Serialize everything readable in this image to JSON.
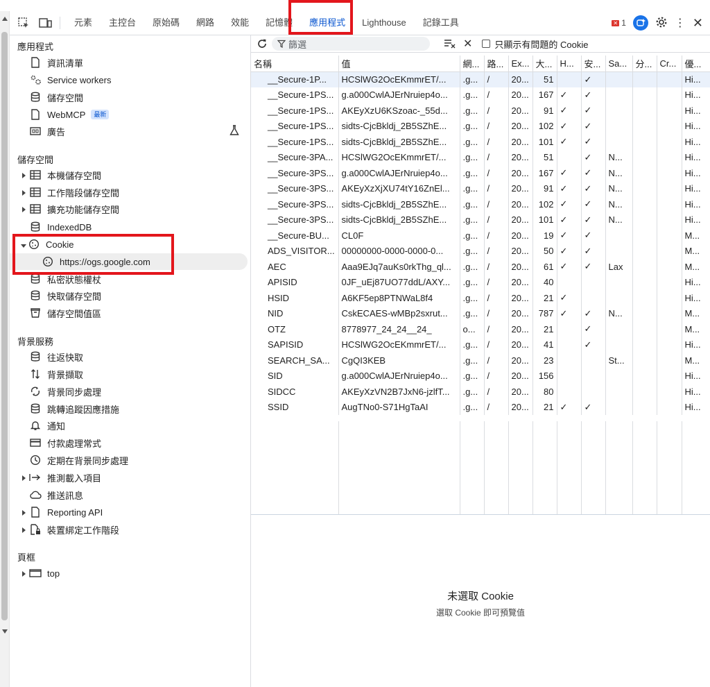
{
  "toolbar": {
    "tabs": [
      "元素",
      "主控台",
      "原始碼",
      "網路",
      "效能",
      "記憶體",
      "應用程式",
      "Lighthouse",
      "記錄工具"
    ],
    "active_tab": "應用程式",
    "error_count": "1"
  },
  "sidebar": {
    "app_section": "應用程式",
    "app_items": [
      "資訊清單",
      "Service workers",
      "儲存空間",
      "WebMCP",
      "廣告"
    ],
    "new_badge": "最新",
    "storage_section": "儲存空間",
    "storage_items": [
      "本機儲存空間",
      "工作階段儲存空間",
      "擴充功能儲存空間",
      "IndexedDB",
      "Cookie",
      "https://ogs.google.com",
      "私密狀態權杖",
      "快取儲存空間",
      "儲存空間值區"
    ],
    "bg_section": "背景服務",
    "bg_items": [
      "往返快取",
      "背景擷取",
      "背景同步處理",
      "跳轉追蹤因應措施",
      "通知",
      "付款處理常式",
      "定期在背景同步處理",
      "推測載入項目",
      "推送訊息",
      "Reporting API",
      "裝置綁定工作階段"
    ],
    "frames_section": "頁框",
    "frames_items": [
      "top"
    ]
  },
  "cookies": {
    "filter_placeholder": "篩選",
    "only_issues_label": "只顯示有問題的 Cookie",
    "columns": [
      "名稱",
      "值",
      "網...",
      "路...",
      "Ex...",
      "大...",
      "H...",
      "安...",
      "Sa...",
      "分...",
      "Cr...",
      "優..."
    ],
    "rows": [
      [
        "__Secure-1P...",
        "HCSlWG2OcEKmmrET/...",
        ".g...",
        "/",
        "20...",
        "51",
        "",
        "✓",
        "",
        "",
        "",
        "Hi..."
      ],
      [
        "__Secure-1PS...",
        "g.a000CwlAJErNruiep4o...",
        ".g...",
        "/",
        "20...",
        "167",
        "✓",
        "✓",
        "",
        "",
        "",
        "Hi..."
      ],
      [
        "__Secure-1PS...",
        "AKEyXzU6KSzoac-_55d...",
        ".g...",
        "/",
        "20...",
        "91",
        "✓",
        "✓",
        "",
        "",
        "",
        "Hi..."
      ],
      [
        "__Secure-1PS...",
        "sidts-CjcBkldj_2B5SZhE...",
        ".g...",
        "/",
        "20...",
        "102",
        "✓",
        "✓",
        "",
        "",
        "",
        "Hi..."
      ],
      [
        "__Secure-1PS...",
        "sidts-CjcBkldj_2B5SZhE...",
        ".g...",
        "/",
        "20...",
        "101",
        "✓",
        "✓",
        "",
        "",
        "",
        "Hi..."
      ],
      [
        "__Secure-3PA...",
        "HCSlWG2OcEKmmrET/...",
        ".g...",
        "/",
        "20...",
        "51",
        "",
        "✓",
        "N...",
        "",
        "",
        "Hi..."
      ],
      [
        "__Secure-3PS...",
        "g.a000CwlAJErNruiep4o...",
        ".g...",
        "/",
        "20...",
        "167",
        "✓",
        "✓",
        "N...",
        "",
        "",
        "Hi..."
      ],
      [
        "__Secure-3PS...",
        "AKEyXzXjXU74tY16ZnEl...",
        ".g...",
        "/",
        "20...",
        "91",
        "✓",
        "✓",
        "N...",
        "",
        "",
        "Hi..."
      ],
      [
        "__Secure-3PS...",
        "sidts-CjcBkldj_2B5SZhE...",
        ".g...",
        "/",
        "20...",
        "102",
        "✓",
        "✓",
        "N...",
        "",
        "",
        "Hi..."
      ],
      [
        "__Secure-3PS...",
        "sidts-CjcBkldj_2B5SZhE...",
        ".g...",
        "/",
        "20...",
        "101",
        "✓",
        "✓",
        "N...",
        "",
        "",
        "Hi..."
      ],
      [
        "__Secure-BU...",
        "CL0F",
        ".g...",
        "/",
        "20...",
        "19",
        "✓",
        "✓",
        "",
        "",
        "",
        "M..."
      ],
      [
        "ADS_VISITOR...",
        "00000000-0000-0000-0...",
        ".g...",
        "/",
        "20...",
        "50",
        "✓",
        "✓",
        "",
        "",
        "",
        "M..."
      ],
      [
        "AEC",
        "Aaa9EJq7auKs0rkThg_ql...",
        ".g...",
        "/",
        "20...",
        "61",
        "✓",
        "✓",
        "Lax",
        "",
        "",
        "M..."
      ],
      [
        "APISID",
        "0JF_uEj87UO77ddL/AXY...",
        ".g...",
        "/",
        "20...",
        "40",
        "",
        "",
        "",
        "",
        "",
        "Hi..."
      ],
      [
        "HSID",
        "A6KF5ep8PTNWaL8f4",
        ".g...",
        "/",
        "20...",
        "21",
        "✓",
        "",
        "",
        "",
        "",
        "Hi..."
      ],
      [
        "NID",
        "CskECAES-wMBp2sxrut...",
        ".g...",
        "/",
        "20...",
        "787",
        "✓",
        "✓",
        "N...",
        "",
        "",
        "M..."
      ],
      [
        "OTZ",
        "8778977_24_24__24_",
        "o...",
        "/",
        "20...",
        "21",
        "",
        "✓",
        "",
        "",
        "",
        "M..."
      ],
      [
        "SAPISID",
        "HCSlWG2OcEKmmrET/...",
        ".g...",
        "/",
        "20...",
        "41",
        "",
        "✓",
        "",
        "",
        "",
        "Hi..."
      ],
      [
        "SEARCH_SA...",
        "CgQI3KEB",
        ".g...",
        "/",
        "20...",
        "23",
        "",
        "",
        "St...",
        "",
        "",
        "M..."
      ],
      [
        "SID",
        "g.a000CwlAJErNruiep4o...",
        ".g...",
        "/",
        "20...",
        "156",
        "",
        "",
        "",
        "",
        "",
        "Hi..."
      ],
      [
        "SIDCC",
        "AKEyXzVN2B7JxN6-jzlfT...",
        ".g...",
        "/",
        "20...",
        "80",
        "",
        "",
        "",
        "",
        "",
        "Hi..."
      ],
      [
        "SSID",
        "AugTNo0-S71HgTaAI",
        ".g...",
        "/",
        "20...",
        "21",
        "✓",
        "✓",
        "",
        "",
        "",
        "Hi..."
      ]
    ],
    "empty_title": "未選取 Cookie",
    "empty_subtitle": "選取 Cookie 即可預覽值"
  },
  "colors": {
    "accent": "#0b57d0",
    "highlight_box": "#e3161c"
  }
}
